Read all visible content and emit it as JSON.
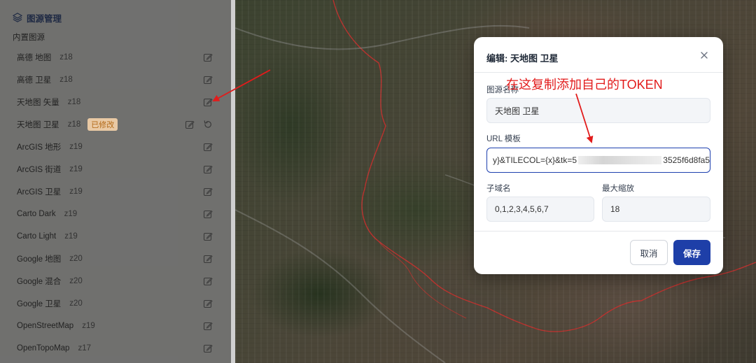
{
  "panel": {
    "title": "图源管理",
    "section_label": "内置图源",
    "items": [
      {
        "name": "高德 地图",
        "zoom": "z18",
        "badge": ""
      },
      {
        "name": "高德 卫星",
        "zoom": "z18",
        "badge": ""
      },
      {
        "name": "天地图 矢量",
        "zoom": "z18",
        "badge": ""
      },
      {
        "name": "天地图 卫星",
        "zoom": "z18",
        "badge": "已修改"
      },
      {
        "name": "ArcGIS 地形",
        "zoom": "z19",
        "badge": ""
      },
      {
        "name": "ArcGIS 街道",
        "zoom": "z19",
        "badge": ""
      },
      {
        "name": "ArcGIS 卫星",
        "zoom": "z19",
        "badge": ""
      },
      {
        "name": "Carto Dark",
        "zoom": "z19",
        "badge": ""
      },
      {
        "name": "Carto Light",
        "zoom": "z19",
        "badge": ""
      },
      {
        "name": "Google 地图",
        "zoom": "z20",
        "badge": ""
      },
      {
        "name": "Google 混合",
        "zoom": "z20",
        "badge": ""
      },
      {
        "name": "Google 卫星",
        "zoom": "z20",
        "badge": ""
      },
      {
        "name": "OpenStreetMap",
        "zoom": "z19",
        "badge": ""
      },
      {
        "name": "OpenTopoMap",
        "zoom": "z17",
        "badge": ""
      }
    ]
  },
  "dialog": {
    "title": "编辑: 天地图 卫星",
    "name_label": "图源名称",
    "name_value": "天地图 卫星",
    "url_label": "URL 模板",
    "url_value_start": "y}&TILECOL={x}&tk=5",
    "url_value_end": "3525f6d8fa5",
    "subdomain_label": "子域名",
    "subdomain_value": "0,1,2,3,4,5,6,7",
    "maxzoom_label": "最大缩放",
    "maxzoom_value": "18",
    "cancel_label": "取消",
    "save_label": "保存"
  },
  "annotation": {
    "text": "在这复制添加自己的TOKEN",
    "color": "#e21b1b"
  },
  "colors": {
    "accent": "#1e3fa8",
    "modified_badge_text": "#b36a18",
    "modified_badge_bg": "#e9c9a4",
    "annotation_red": "#e21b1b"
  }
}
